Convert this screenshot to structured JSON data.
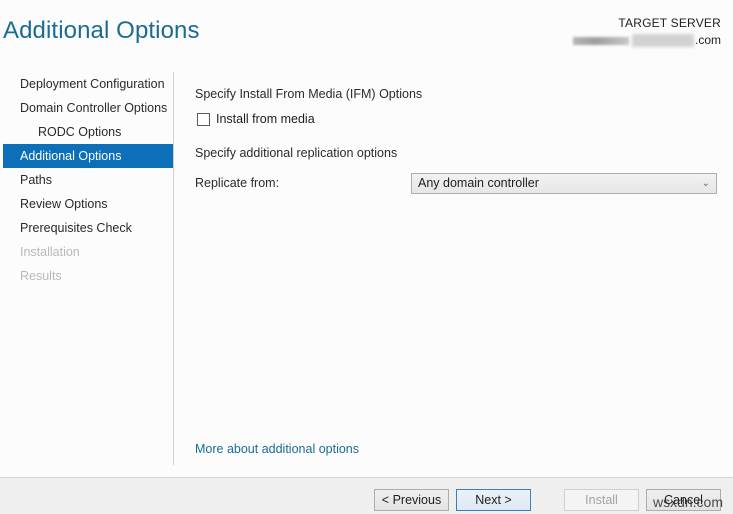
{
  "header": {
    "title": "Additional Options",
    "target_label": "TARGET SERVER",
    "target_server_suffix": ".com"
  },
  "sidebar": {
    "items": [
      {
        "label": "Deployment Configuration",
        "state": "normal",
        "level": 0
      },
      {
        "label": "Domain Controller Options",
        "state": "normal",
        "level": 0
      },
      {
        "label": "RODC Options",
        "state": "normal",
        "level": 1
      },
      {
        "label": "Additional Options",
        "state": "active",
        "level": 0
      },
      {
        "label": "Paths",
        "state": "normal",
        "level": 0
      },
      {
        "label": "Review Options",
        "state": "normal",
        "level": 0
      },
      {
        "label": "Prerequisites Check",
        "state": "normal",
        "level": 0
      },
      {
        "label": "Installation",
        "state": "disabled",
        "level": 0
      },
      {
        "label": "Results",
        "state": "disabled",
        "level": 0
      }
    ]
  },
  "main": {
    "ifm_heading": "Specify Install From Media (IFM) Options",
    "install_from_media_label": "Install from media",
    "install_from_media_checked": false,
    "replication_heading": "Specify additional replication options",
    "replicate_from_label": "Replicate from:",
    "replicate_from_value": "Any domain controller",
    "more_link": "More about additional options"
  },
  "footer": {
    "previous_label": "< Previous",
    "next_label": "Next >",
    "install_label": "Install",
    "cancel_label": "Cancel",
    "watermark": "wsxdn.com"
  },
  "colors": {
    "accent": "#0d6fb8",
    "title": "#1a6c93",
    "link": "#1a6c93"
  }
}
